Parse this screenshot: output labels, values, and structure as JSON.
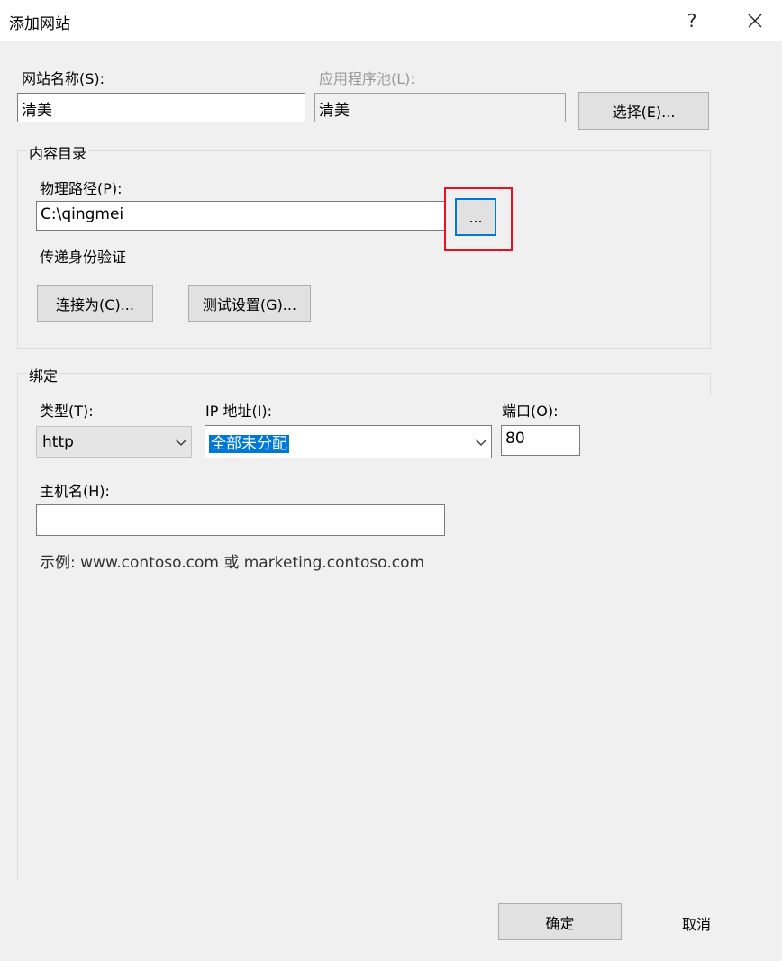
{
  "window": {
    "title": "添加网站",
    "help": "?",
    "close": "✕"
  },
  "site": {
    "name_label": "网站名称(S):",
    "name_value": "清美",
    "pool_label": "应用程序池(L):",
    "pool_value": "清美",
    "select_button": "选择(E)..."
  },
  "content_dir": {
    "group_title": "内容目录",
    "path_label": "物理路径(P):",
    "path_value": "C:\\qingmei",
    "browse_button": "...",
    "auth_label": "传递身份验证",
    "connect_as_button": "连接为(C)...",
    "test_settings_button": "测试设置(G)..."
  },
  "binding": {
    "group_title": "绑定",
    "type_label": "类型(T):",
    "type_value": "http",
    "ip_label": "IP 地址(I):",
    "ip_value": "全部未分配",
    "port_label": "端口(O):",
    "port_value": "80",
    "host_label": "主机名(H):",
    "host_value": "",
    "example_text": "示例: www.contoso.com 或 marketing.contoso.com"
  },
  "footer": {
    "ok_button": "确定",
    "cancel_button": "取消"
  },
  "colors": {
    "accent": "#0078d7",
    "highlight_box": "#e81123",
    "dialog_bg": "#f0f0f0"
  }
}
